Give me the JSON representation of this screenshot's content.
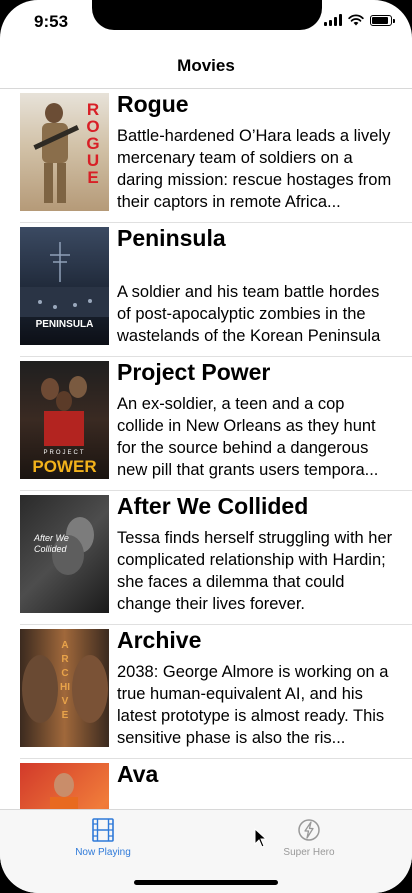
{
  "status": {
    "time": "9:53"
  },
  "nav": {
    "title": "Movies"
  },
  "movies": [
    {
      "title": "Rogue",
      "overview": "Battle-hardened O’Hara leads a lively mercenary team of soldiers on a daring mission: rescue hostages from their captors in remote Africa...",
      "poster_text": "ROGUE"
    },
    {
      "title": "Peninsula",
      "overview": "A soldier and his team battle hordes of post-apocalyptic zombies in the wastelands of the Korean Peninsula",
      "poster_text": "PENINSULA"
    },
    {
      "title": "Project Power",
      "overview": "An ex-soldier, a teen and a cop collide in New Orleans as they hunt for the source behind a dangerous new pill that grants users tempora...",
      "poster_text": "POWER",
      "poster_subtext": "PROJECT"
    },
    {
      "title": "After We Collided",
      "overview": "Tessa finds herself struggling with her complicated relationship with Hardin; she faces a dilemma that could change their lives forever.",
      "poster_text": "After We Collided"
    },
    {
      "title": "Archive",
      "overview": "2038: George Almore is working on a true human-equivalent AI, and his latest prototype is almost ready. This sensitive phase is also the ris...",
      "poster_text": "ARCHIVE"
    },
    {
      "title": "Ava",
      "overview": "",
      "poster_text": ""
    }
  ],
  "tabs": [
    {
      "label": "Now Playing",
      "icon": "film-strip-icon",
      "selected": true,
      "color": "#2f7ad9"
    },
    {
      "label": "Super Hero",
      "icon": "flash-icon",
      "selected": false,
      "color": "#999999"
    }
  ]
}
